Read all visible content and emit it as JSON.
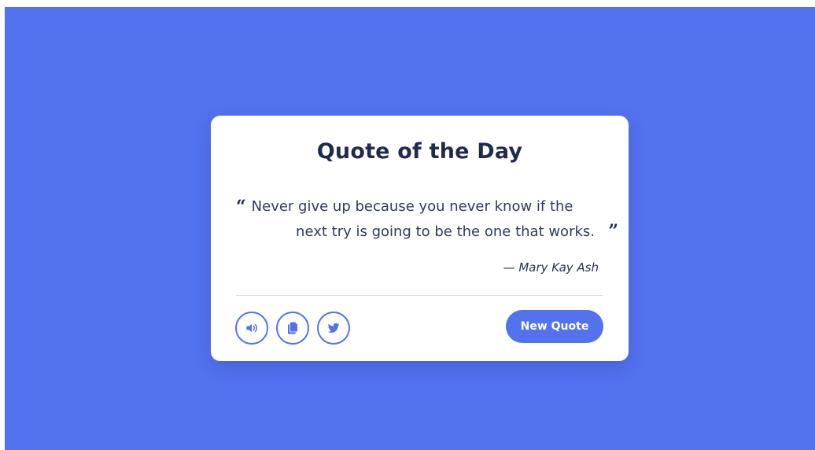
{
  "card": {
    "title": "Quote of the Day",
    "quote_line_1": "Never give up because you never know if the",
    "quote_line_2": "next try is going to be the one that works.",
    "author": "— Mary Kay Ash",
    "new_quote_label": "New Quote"
  },
  "actions": {
    "icons": [
      "volume-icon",
      "copy-icon",
      "twitter-icon"
    ]
  },
  "colors": {
    "background": "#5372f0",
    "accent": "#5372f0",
    "card": "#ffffff",
    "title": "#1f2a4f"
  }
}
